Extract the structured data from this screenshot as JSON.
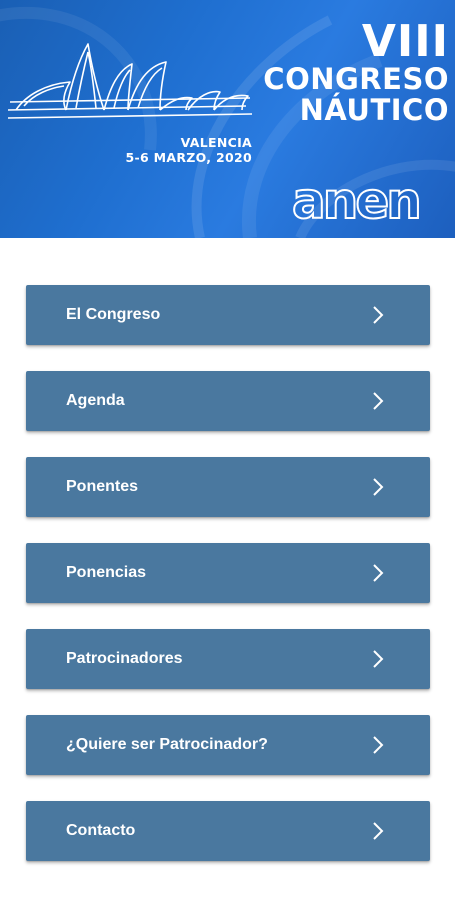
{
  "banner": {
    "edition": "VIII",
    "title_line_1": "CONGRESO",
    "title_line_2": "NÁUTICO",
    "city": "VALENCIA",
    "dates": "5-6 MARZO, 2020",
    "brand": "anen",
    "colors": {
      "background": "#1f6fd0",
      "text": "#ffffff"
    }
  },
  "menu": {
    "item_color": "#4a789f",
    "chevron_icon": "chevron-right-icon",
    "items": [
      {
        "label": "El Congreso"
      },
      {
        "label": "Agenda"
      },
      {
        "label": "Ponentes"
      },
      {
        "label": "Ponencias"
      },
      {
        "label": "Patrocinadores"
      },
      {
        "label": "¿Quiere ser Patrocinador?"
      },
      {
        "label": "Contacto"
      }
    ]
  }
}
